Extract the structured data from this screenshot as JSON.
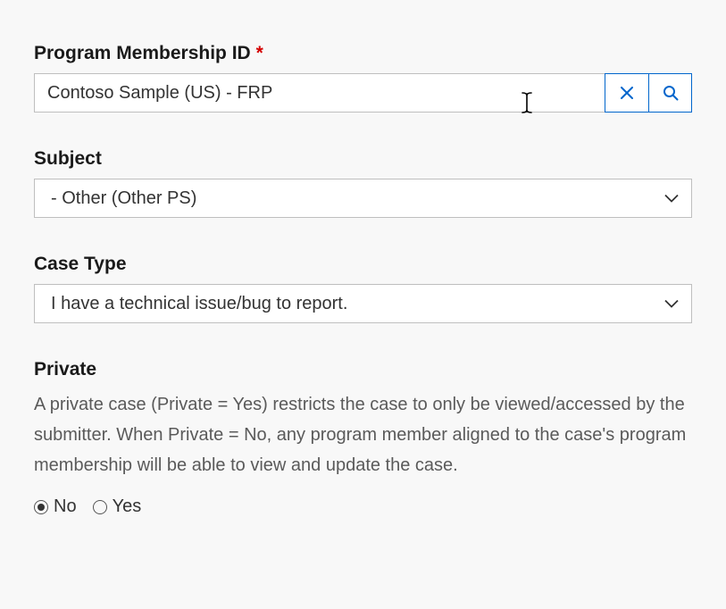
{
  "programMembership": {
    "label": "Program Membership ID",
    "required": true,
    "value": "Contoso Sample (US) - FRP"
  },
  "subject": {
    "label": "Subject",
    "selected": " - Other (Other PS)"
  },
  "caseType": {
    "label": "Case Type",
    "selected": "I have a technical issue/bug to report."
  },
  "private": {
    "label": "Private",
    "help": "A private case (Private = Yes) restricts the case to only be viewed/accessed by the submitter. When Private = No, any program member aligned to the case's program membership will be able to view and update the case.",
    "options": {
      "no": "No",
      "yes": "Yes"
    },
    "selected": "no"
  },
  "colors": {
    "accent": "#0066cc"
  }
}
